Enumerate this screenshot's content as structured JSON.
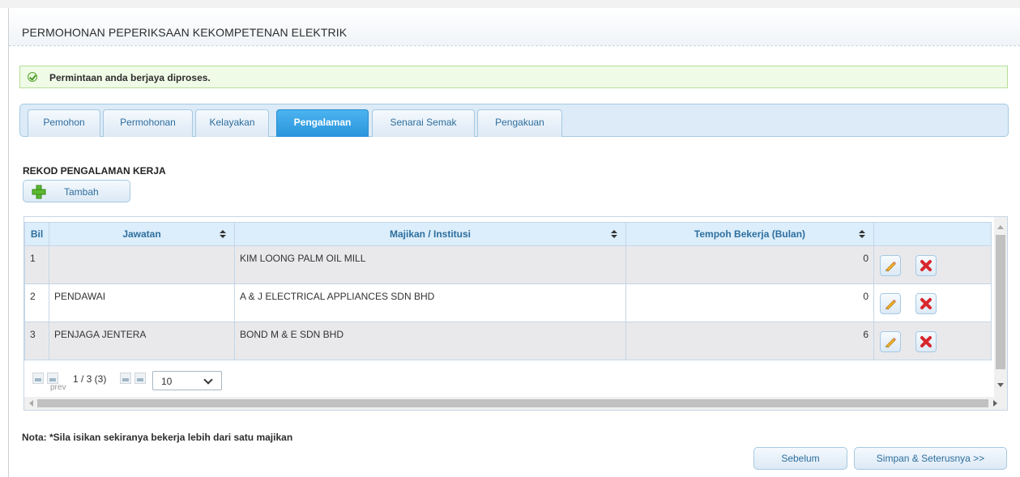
{
  "panel": {
    "title": "PERMOHONAN PEPERIKSAAN KEKOMPETENAN ELEKTRIK"
  },
  "message": {
    "text": "Permintaan anda berjaya diproses."
  },
  "tabs": [
    {
      "label": "Pemohon"
    },
    {
      "label": "Permohonan"
    },
    {
      "label": "Kelayakan"
    },
    {
      "label": "Pengalaman",
      "active": true
    },
    {
      "label": "Senarai Semak"
    },
    {
      "label": "Pengakuan"
    }
  ],
  "section": {
    "title": "REKOD PENGALAMAN KERJA",
    "add_label": "Tambah"
  },
  "table": {
    "headers": {
      "bil": "Bil",
      "jawatan": "Jawatan",
      "majikan": "Majikan / Institusi",
      "tempoh": "Tempoh Bekerja (Bulan)"
    },
    "rows": [
      {
        "bil": "1",
        "jawatan": "",
        "majikan": "KIM LOONG PALM OIL MILL",
        "tempoh": "0"
      },
      {
        "bil": "2",
        "jawatan": "PENDAWAI",
        "majikan": "A & J ELECTRICAL APPLIANCES SDN BHD",
        "tempoh": "0"
      },
      {
        "bil": "3",
        "jawatan": "PENJAGA JENTERA",
        "majikan": "BOND M & E SDN BHD",
        "tempoh": "6"
      }
    ]
  },
  "pager": {
    "info": "1 / 3 (3)",
    "prev_alt": "prev",
    "page_size": "10"
  },
  "note": "Nota: *Sila isikan sekiranya bekerja lebih dari satu majikan",
  "buttons": {
    "back": "Sebelum",
    "save_next": "Simpan & Seterusnya >>"
  }
}
